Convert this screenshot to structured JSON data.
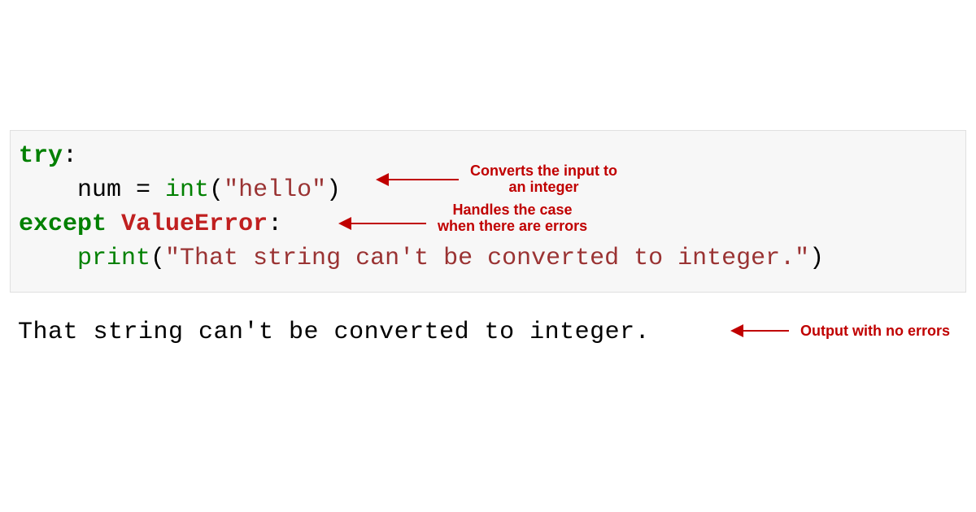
{
  "code": {
    "line1_kw": "try",
    "line1_colon": ":",
    "line2_var": "num ",
    "line2_eq": "= ",
    "line2_fn": "int",
    "line2_open": "(",
    "line2_str": "\"hello\"",
    "line2_close": ")",
    "line3_kw": "except",
    "line3_sp": " ",
    "line3_exc": "ValueError",
    "line3_colon": ":",
    "line4_fn": "print",
    "line4_open": "(",
    "line4_str": "\"That string can't be converted to integer.\"",
    "line4_close": ")"
  },
  "output": "That string can't be converted to integer.",
  "annotations": {
    "a1_l1": "Converts the input to",
    "a1_l2": "an integer",
    "a2_l1": "Handles the case",
    "a2_l2": "when there are errors",
    "a3": "Output with no errors"
  }
}
